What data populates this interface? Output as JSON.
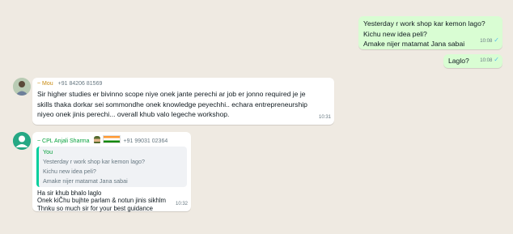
{
  "messages": {
    "outgoing_1": {
      "lines": [
        "Yesterday r work shop kar kemon lago?",
        "Kichu new idea peli?",
        "Amake nijer matamat Jana sabai"
      ],
      "time": "10:08",
      "tick": "✓"
    },
    "outgoing_2": {
      "text": "Laglo?",
      "time": "10:08",
      "tick": "✓"
    },
    "incoming_1": {
      "sender_name": "~ Mou",
      "sender_phone": "+91 84206 81569",
      "lines": [
        "Sir higher studies er bivinno scope niye onek jante perechi ar job er jonno required je je",
        "skills thaka dorkar sei sommondhe onek knowledge peyechhi.. echara entrepreneurship",
        "niyeo onek jinis perechi... overall khub valo legeche workshop."
      ],
      "time": "10:31"
    },
    "incoming_2": {
      "sender_name": "~ CPL Anjali Sharma",
      "sender_phone": "+91 99031 02364",
      "quote": {
        "author": "You",
        "lines": [
          "Yesterday r work shop kar kemon lago?",
          "Kichu new idea peli?",
          "Amake nijer matamat Jana sabai"
        ]
      },
      "lines": [
        "Ha sir khub bhalo laglo",
        "Onek kiČhu bujhte parlam & notun jinis sikhlm",
        "Thnku so much sir for your best guidance"
      ],
      "time": "10:32"
    }
  }
}
